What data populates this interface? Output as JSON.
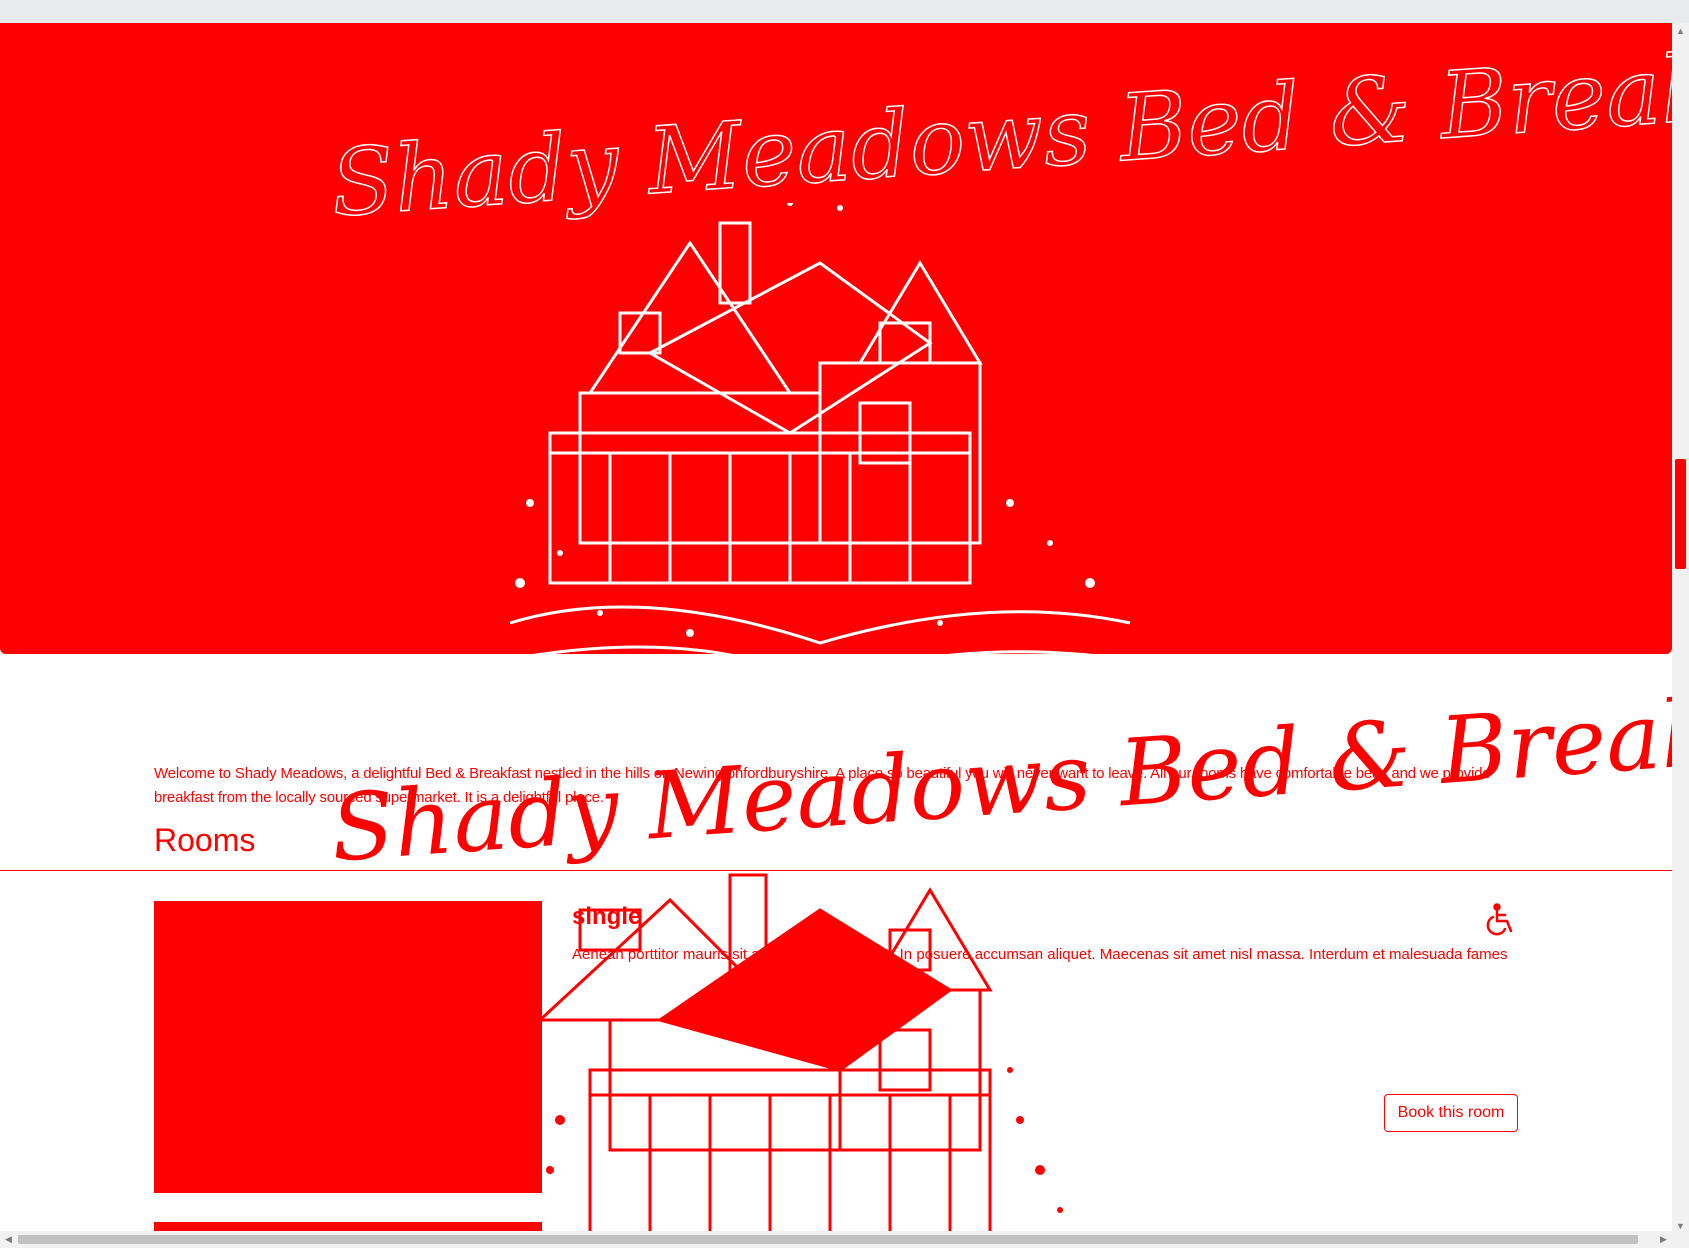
{
  "hero": {
    "title": "Shady Meadows Bed & Breakfast",
    "image_icon": "house-illustration-icon"
  },
  "intro": {
    "welcome_text": "Welcome to Shady Meadows, a delightful Bed & Breakfast nestled in the hills on Newingtonfordburyshire. A place so beautiful you will never want to leave. All our rooms have comfortable beds and we provide breakfast from the locally sourced supermarket. It is a delightful place."
  },
  "rooms": {
    "heading": "Rooms",
    "items": [
      {
        "name": "single",
        "description": "Aenean porttitor mauris sit amet lacinia molestie. In posuere accumsan aliquet. Maecenas sit amet nisl massa. Interdum et malesuada fames",
        "accessible_icon": "wheelchair-icon",
        "book_label": "Book this room"
      }
    ]
  },
  "colors": {
    "accent": "#ff0000",
    "background": "#ffffff"
  }
}
